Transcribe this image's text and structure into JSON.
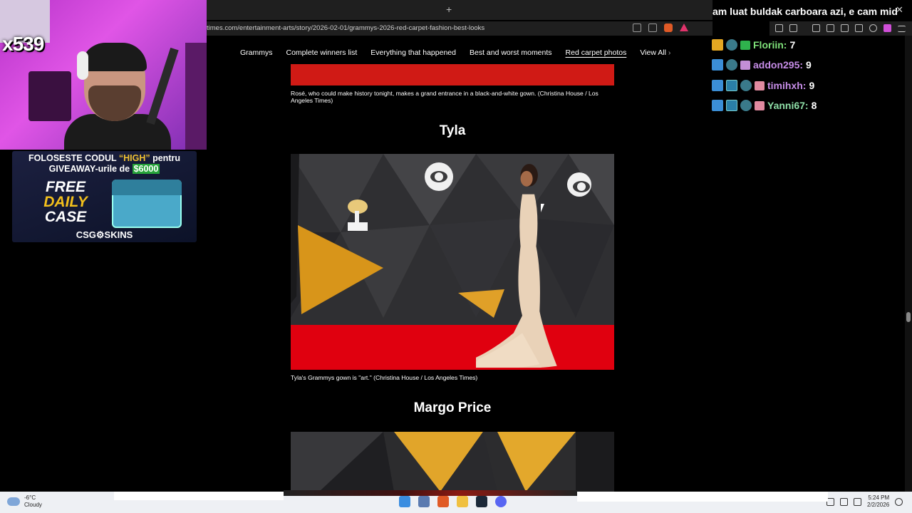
{
  "browser": {
    "url": "times.com/entertainment-arts/story/2026-02-01/grammys-2026-red-carpet-fashion-best-looks",
    "new_tab": "+",
    "close": "✕"
  },
  "site_nav": {
    "items": [
      {
        "label": "Grammys"
      },
      {
        "label": "Complete winners list"
      },
      {
        "label": "Everything that happened"
      },
      {
        "label": "Best and worst moments"
      },
      {
        "label": "Red carpet photos",
        "active": true
      },
      {
        "label": "View All"
      }
    ],
    "chevron": "›"
  },
  "article": {
    "caption_top": "Rosé, who could make history tonight, makes a grand entrance in a black-and-white gown.  (Christina House / Los Angeles Times)",
    "heading_1": "Tyla",
    "caption_1": "Tyla's Grammys gown is \"art.\"  (Christina House / Los Angeles Times)",
    "heading_2": "Margo Price"
  },
  "stream_overlay": {
    "counter": "x539",
    "chat_message": "am luat buldak carboara azi, e cam mid",
    "leaderboard": [
      {
        "name": "Floriin:",
        "value": "7",
        "color": "#7fe27a"
      },
      {
        "name": "addon295:",
        "value": "9",
        "color": "#c78de8"
      },
      {
        "name": "timihxh:",
        "value": "9",
        "color": "#c78de8"
      },
      {
        "name": "Yanni67:",
        "value": "8",
        "color": "#8fe0a8"
      }
    ],
    "promo": {
      "line1_a": "FOLOSESTE CODUL ",
      "line1_code": "“HIGH”",
      "line1_b": " pentru",
      "line2_a": "GIVEAWAY-urile de ",
      "line2_amount": "$6000",
      "free": "FREE",
      "daily": "DAILY",
      "case": "CASE",
      "brand": "CSG⚙SKINS"
    }
  },
  "taskbar": {
    "temp": "-6°C",
    "weather": "Cloudy",
    "time": "5:24 PM",
    "date": "2/2/2026"
  }
}
